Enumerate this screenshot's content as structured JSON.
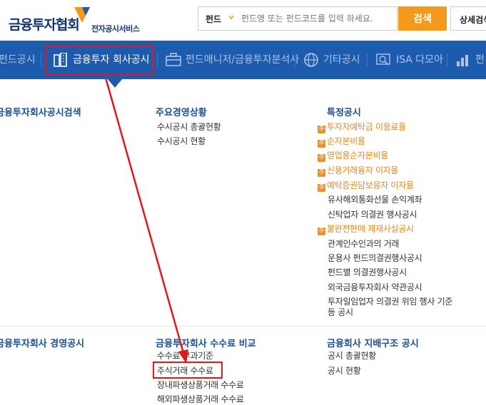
{
  "header": {
    "logo_main": "금융투자협회",
    "logo_sub": "전자공시서비스",
    "search_category": "펀드",
    "search_placeholder": "펀드명 또는 펀드코드를 입력 하세요.",
    "search_button": "검색",
    "detail_button": "상세검색"
  },
  "nav": {
    "items": [
      {
        "label": "펀드공시",
        "icon": "chart-icon"
      },
      {
        "label": "금융투자 회사공시",
        "icon": "building-icon"
      },
      {
        "label": "펀드매니저/금융투자분석사",
        "icon": "briefcase-icon"
      },
      {
        "label": "기타공시",
        "icon": "globe-icon"
      },
      {
        "label": "ISA 다모아",
        "icon": "isa-search-icon"
      },
      {
        "label": "펀",
        "icon": "bar-chart-icon"
      }
    ]
  },
  "menu": {
    "col1_head_top": "금융투자회사공시검색",
    "col1_head_bottom": "금융투자회사 경영공시",
    "col2_head_top": "주요경영상황",
    "col2_top_links": [
      "수시공시 총괄현황",
      "수시공시 현황"
    ],
    "col3_head_top": "특정공시",
    "col3_orange_links": [
      "투자자예탁금 이용료율",
      "순자본비율",
      "영업용순자본비율",
      "신용거래융자 이자율",
      "예탁증권담보융자 이자율"
    ],
    "col3_plain_links_a": [
      "유사해외통화선물 손익계좌",
      "신탁업자 의결권 행사공시"
    ],
    "col3_orange_link_b": "불완전판매 제재사실공시",
    "col3_plain_links_c": [
      "관계인수인과의 거래",
      "운용사 펀드의결권행사공시",
      "펀드별 의결권행사공시",
      "외국금융투자회사 약관공시",
      "투자일임업자 의결권 위임 행사 기준",
      "등 공시"
    ],
    "col2_head_bottom": "금융투자회사 수수료 비교",
    "col2_bottom_links": [
      "수수료 부과기준",
      "주식거래 수수료",
      "장내파생상품거래 수수료",
      "해외파생상품거래 수수료"
    ],
    "col3_head_bottom": "금융회사 지배구조 공시",
    "col3_bottom_links": [
      "공시 총괄현황",
      "공시 현황"
    ],
    "badge_char": "주"
  },
  "colors": {
    "brand_navy": "#12356f",
    "nav_blue": "#1c5bad",
    "search_orange": "#f39a1d",
    "link_orange": "#e8881b",
    "highlight_red": "#e3161a"
  }
}
